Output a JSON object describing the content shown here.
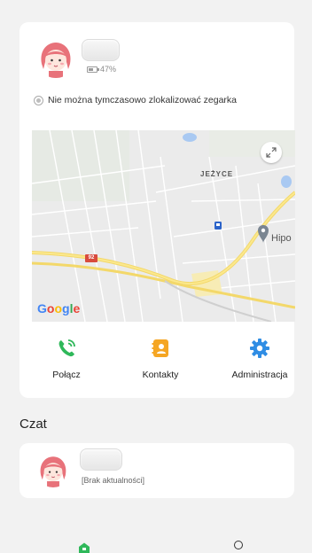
{
  "device": {
    "battery_text": "47%",
    "battery_level": 0.47,
    "locate_message": "Nie można tymczasowo zlokalizować zegarka"
  },
  "map": {
    "district_label": "JEŻYCE",
    "poi_label": "Hipo",
    "road_number": "92",
    "logo_parts": [
      "G",
      "o",
      "o",
      "g",
      "l",
      "e"
    ]
  },
  "actions": {
    "call_label": "Połącz",
    "contacts_label": "Kontakty",
    "admin_label": "Administracja"
  },
  "chat": {
    "section_title": "Czat",
    "status_text": "[Brak aktualności]"
  },
  "colors": {
    "call_green": "#2fb85a",
    "contacts_orange": "#f5a623",
    "admin_blue": "#2f8de4",
    "card_bg": "#ffffff",
    "page_bg": "#f2f2f2"
  }
}
